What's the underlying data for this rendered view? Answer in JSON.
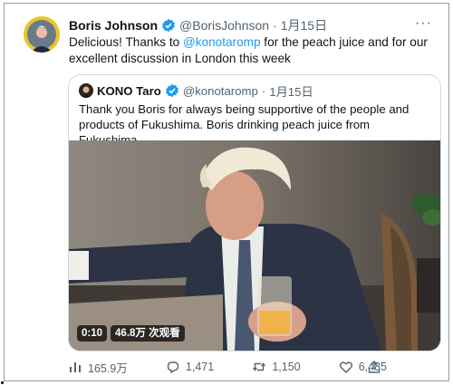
{
  "tweet": {
    "author_name": "Boris Johnson",
    "handle": "@BorisJohnson",
    "separator": "·",
    "date": "1月15日",
    "more_label": "···",
    "text_before": "Delicious! Thanks to ",
    "mention": "@konotaromp",
    "text_after": " for the peach juice and for our excellent discussion in London this week"
  },
  "quoted": {
    "author_name": "KONO Taro",
    "handle": "@konotaromp",
    "separator": "·",
    "date": "1月15日",
    "text": "Thank you Boris for always being supportive of the people and products of Fukushima. Boris drinking peach juice from Fukushima.",
    "video": {
      "duration": "0:10",
      "views": "46.8万 次观看"
    }
  },
  "actions": {
    "views": "165.9万",
    "replies": "1,471",
    "retweets": "1,150",
    "likes": "6,485"
  },
  "colors": {
    "accent": "#1d9bf0",
    "text": "#0f1419",
    "muted": "#536471"
  },
  "icons": [
    "verified-badge-icon",
    "more-icon",
    "views-icon",
    "reply-icon",
    "retweet-icon",
    "like-icon",
    "share-icon"
  ]
}
